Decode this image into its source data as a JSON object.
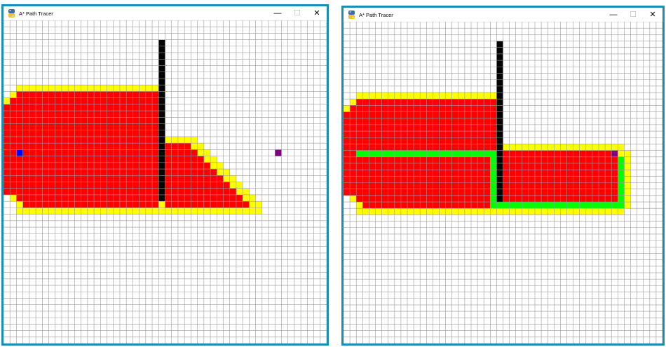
{
  "windows": [
    {
      "id": "left",
      "title": "A* Path Tracer",
      "controls": {
        "minimize": "—",
        "maximize": "☐",
        "close": "✕"
      },
      "grid": {
        "cols": 50,
        "rows": 50
      },
      "colors": {
        "closed": "#ff0000",
        "open": "#ffff00",
        "barrier": "#000000",
        "start": "#0000ff",
        "end": "#800080",
        "path": "#00ff00"
      },
      "start": {
        "col": 2,
        "row": 20
      },
      "end": {
        "col": 42,
        "row": 20
      },
      "barrier": {
        "col": 24,
        "row_start": 3,
        "row_end": 27
      },
      "path_cells": []
    },
    {
      "id": "right",
      "title": "A* Path Tracer",
      "controls": {
        "minimize": "—",
        "maximize": "☐",
        "close": "✕"
      },
      "grid": {
        "cols": 50,
        "rows": 50
      },
      "colors": {
        "closed": "#ff0000",
        "open": "#ffff00",
        "barrier": "#000000",
        "start": "#0000ff",
        "end": "#800080",
        "path": "#00ff00"
      },
      "start": null,
      "end": {
        "col": 42,
        "row": 20
      },
      "barrier": {
        "col": 24,
        "row_start": 3,
        "row_end": 27
      },
      "path_cells": "L-shaped route from left edge along row 20, down col 23, along row 28, up col 43"
    }
  ]
}
